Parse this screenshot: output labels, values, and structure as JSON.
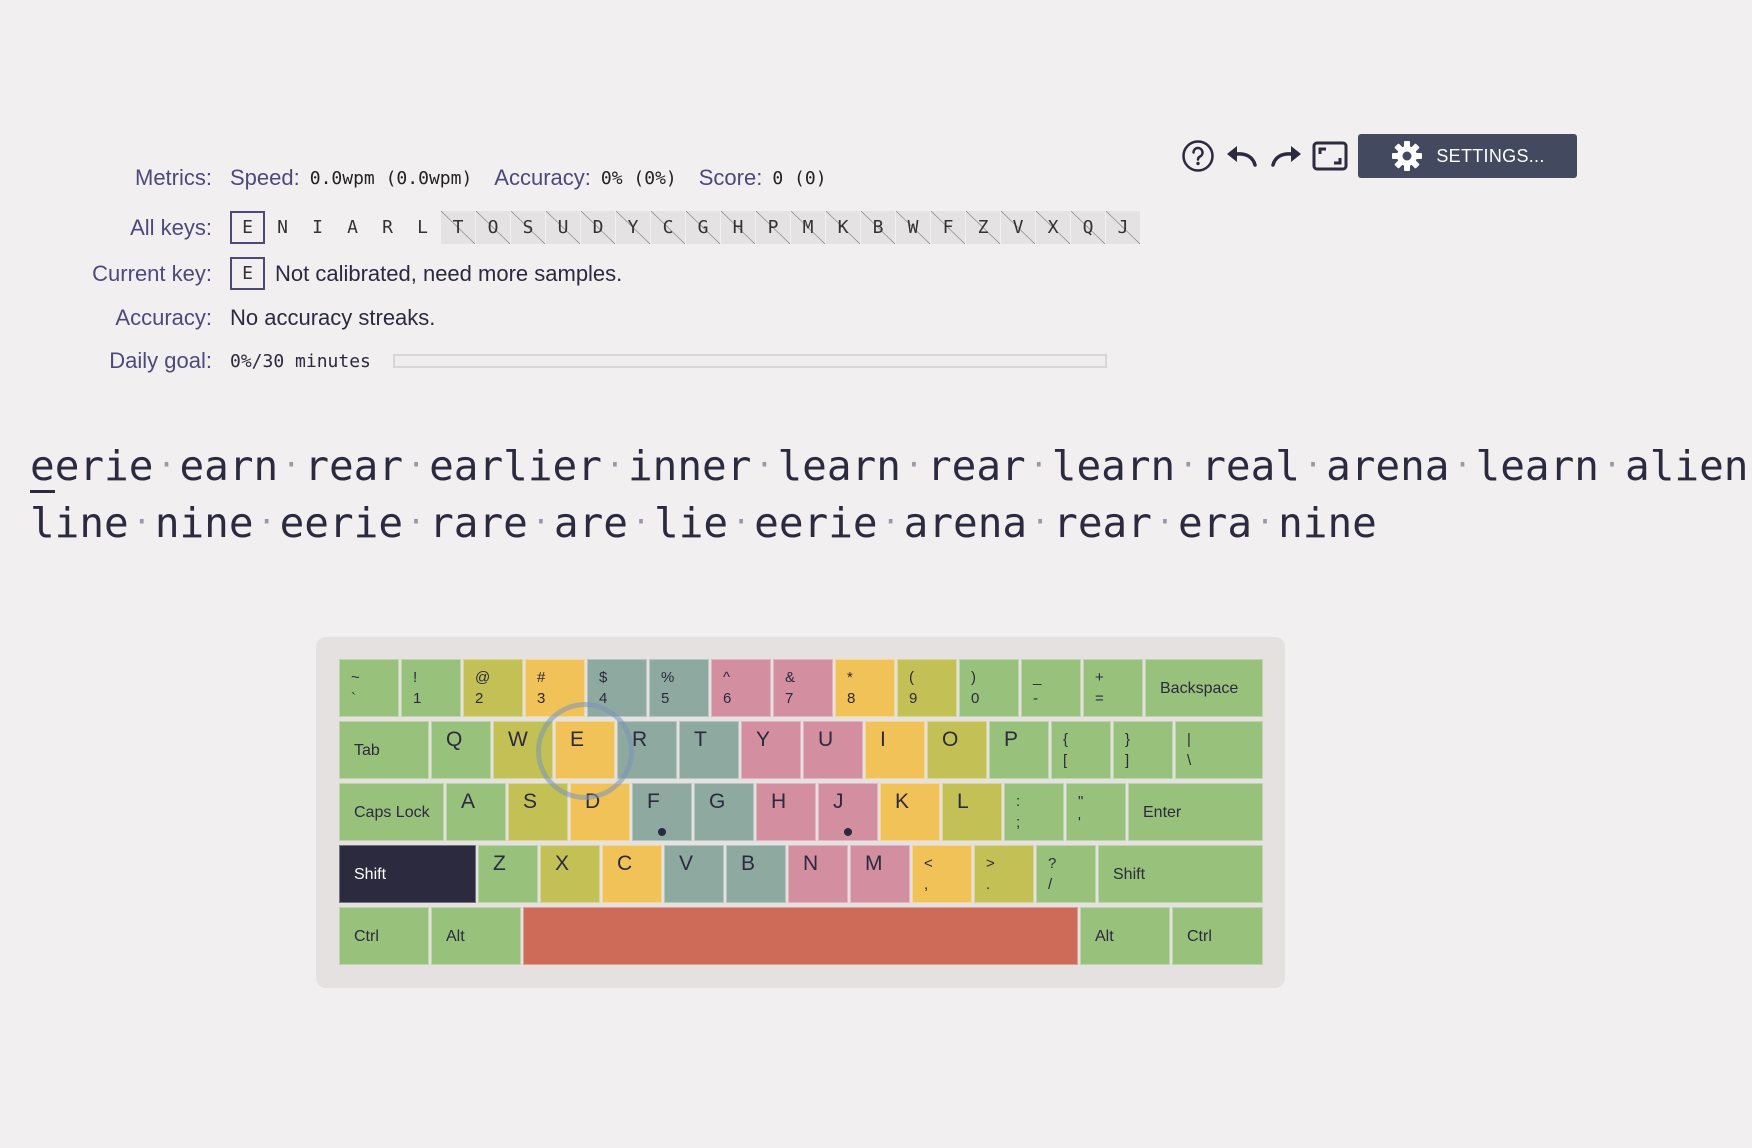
{
  "toolbar": {
    "settings_label": "SETTINGS...",
    "icons": [
      "help-icon",
      "undo-icon",
      "redo-icon",
      "fullscreen-icon",
      "gear-icon"
    ]
  },
  "metrics": {
    "label": "Metrics:",
    "speed_name": "Speed:",
    "speed_value": "0.0wpm (0.0wpm)",
    "accuracy_name": "Accuracy:",
    "accuracy_value": "0% (0%)",
    "score_name": "Score:",
    "score_value": "0 (0)"
  },
  "all_keys": {
    "label": "All keys:",
    "selected": "E",
    "unlocked": [
      "E",
      "N",
      "I",
      "A",
      "R",
      "L"
    ],
    "locked": [
      "T",
      "O",
      "S",
      "U",
      "D",
      "Y",
      "C",
      "G",
      "H",
      "P",
      "M",
      "K",
      "B",
      "W",
      "F",
      "Z",
      "V",
      "X",
      "Q",
      "J"
    ]
  },
  "current_key": {
    "label": "Current key:",
    "key": "E",
    "status": "Not calibrated, need more samples."
  },
  "accuracy_row": {
    "label": "Accuracy:",
    "text": "No accuracy streaks."
  },
  "daily_goal": {
    "label": "Daily goal:",
    "value": "0%/30 minutes",
    "progress": 0
  },
  "lesson": {
    "line1": [
      "eerie",
      "earn",
      "rear",
      "earlier",
      "inner",
      "learn",
      "rear",
      "learn",
      "real",
      "arena",
      "learn",
      "alien"
    ],
    "line2": [
      "line",
      "nine",
      "eerie",
      "rare",
      "are",
      "lie",
      "eerie",
      "arena",
      "rear",
      "era",
      "nine"
    ],
    "separator": "·",
    "cursor_index": 0
  },
  "colors": {
    "green": "#98c17c",
    "olive": "#c3c156",
    "yellow": "#f1c257",
    "teal": "#8ea99f",
    "pink": "#d38ea0",
    "space": "#cd6a58",
    "shift_active": "#2b2a3e",
    "accent": "#4d4a7a",
    "settings_bg": "#434a60"
  },
  "keyboard": {
    "row1": [
      {
        "top": "~",
        "bot": "`",
        "c": "green"
      },
      {
        "top": "!",
        "bot": "1",
        "c": "green"
      },
      {
        "top": "@",
        "bot": "2",
        "c": "olive"
      },
      {
        "top": "#",
        "bot": "3",
        "c": "yellow"
      },
      {
        "top": "$",
        "bot": "4",
        "c": "teal"
      },
      {
        "top": "%",
        "bot": "5",
        "c": "teal"
      },
      {
        "top": "^",
        "bot": "6",
        "c": "pink"
      },
      {
        "top": "&",
        "bot": "7",
        "c": "pink"
      },
      {
        "top": "*",
        "bot": "8",
        "c": "yellow"
      },
      {
        "top": "(",
        "bot": "9",
        "c": "olive"
      },
      {
        "top": ")",
        "bot": "0",
        "c": "green"
      },
      {
        "top": "_",
        "bot": "-",
        "c": "green"
      },
      {
        "top": "+",
        "bot": "=",
        "c": "green"
      },
      {
        "name": "Backspace",
        "c": "green"
      }
    ],
    "row2": [
      {
        "name": "Tab",
        "c": "green"
      },
      {
        "letter": "Q",
        "c": "green"
      },
      {
        "letter": "W",
        "c": "olive"
      },
      {
        "letter": "E",
        "c": "yellow"
      },
      {
        "letter": "R",
        "c": "teal"
      },
      {
        "letter": "T",
        "c": "teal"
      },
      {
        "letter": "Y",
        "c": "pink"
      },
      {
        "letter": "U",
        "c": "pink"
      },
      {
        "letter": "I",
        "c": "yellow"
      },
      {
        "letter": "O",
        "c": "olive"
      },
      {
        "letter": "P",
        "c": "green"
      },
      {
        "top": "{",
        "bot": "[",
        "c": "green"
      },
      {
        "top": "}",
        "bot": "]",
        "c": "green"
      },
      {
        "top": "|",
        "bot": "\\",
        "c": "green"
      }
    ],
    "row3": [
      {
        "name": "Caps Lock",
        "c": "green"
      },
      {
        "letter": "A",
        "c": "green"
      },
      {
        "letter": "S",
        "c": "olive"
      },
      {
        "letter": "D",
        "c": "yellow"
      },
      {
        "letter": "F",
        "c": "teal",
        "bump": true
      },
      {
        "letter": "G",
        "c": "teal"
      },
      {
        "letter": "H",
        "c": "pink"
      },
      {
        "letter": "J",
        "c": "pink",
        "bump": true
      },
      {
        "letter": "K",
        "c": "yellow"
      },
      {
        "letter": "L",
        "c": "olive"
      },
      {
        "top": ":",
        "bot": ";",
        "c": "green"
      },
      {
        "top": "\"",
        "bot": "'",
        "c": "green"
      },
      {
        "name": "Enter",
        "c": "green"
      }
    ],
    "row4": [
      {
        "name": "Shift",
        "c": "shift_active",
        "active": true
      },
      {
        "letter": "Z",
        "c": "green"
      },
      {
        "letter": "X",
        "c": "olive"
      },
      {
        "letter": "C",
        "c": "yellow"
      },
      {
        "letter": "V",
        "c": "teal"
      },
      {
        "letter": "B",
        "c": "teal"
      },
      {
        "letter": "N",
        "c": "pink"
      },
      {
        "letter": "M",
        "c": "pink"
      },
      {
        "top": "<",
        "bot": ",",
        "c": "yellow"
      },
      {
        "top": ">",
        "bot": ".",
        "c": "olive"
      },
      {
        "top": "?",
        "bot": "/",
        "c": "green"
      },
      {
        "name": "Shift",
        "c": "green"
      }
    ],
    "row5": [
      {
        "name": "Ctrl",
        "c": "green"
      },
      {
        "name": "Alt",
        "c": "green"
      },
      {
        "name": "",
        "c": "space"
      },
      {
        "name": "Alt",
        "c": "green"
      },
      {
        "name": "Ctrl",
        "c": "green"
      }
    ]
  }
}
